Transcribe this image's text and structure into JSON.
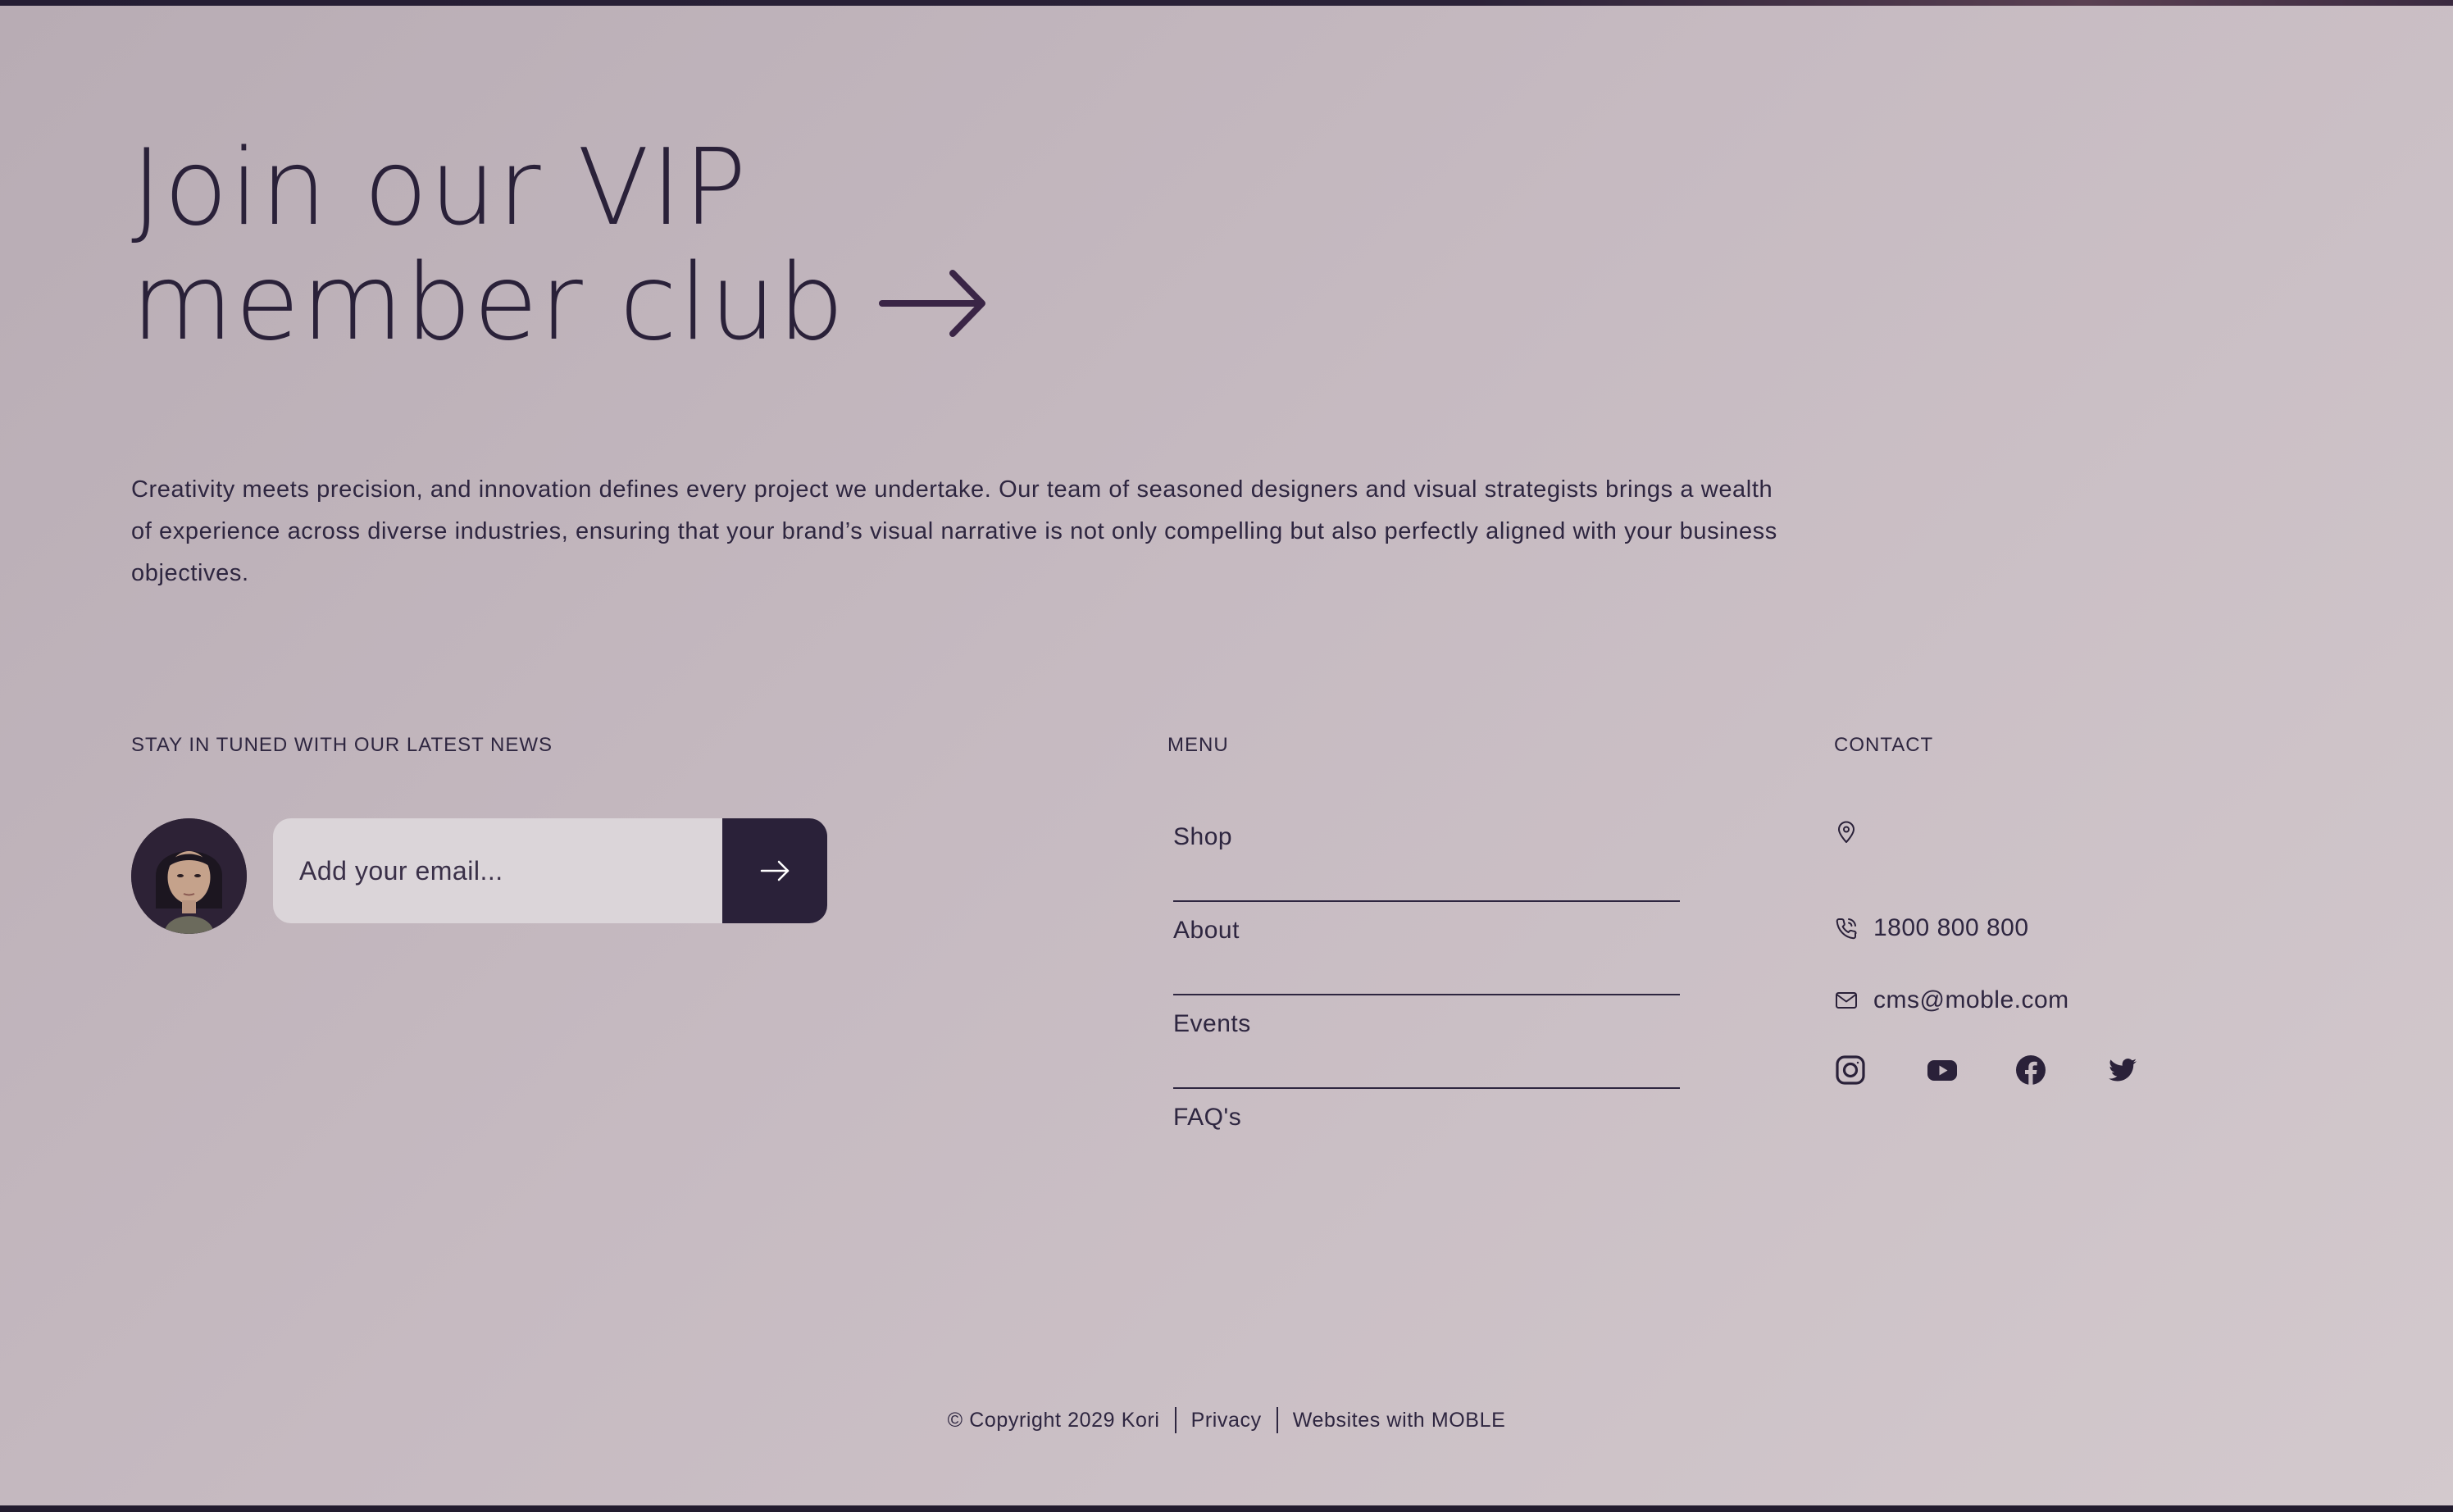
{
  "hero": {
    "title_line1": "Join our VIP",
    "title_line2": "member club"
  },
  "description": "Creativity meets precision, and innovation defines every project we undertake. Our team of seasoned designers and visual strategists brings a wealth of experience across diverse industries, ensuring that your brand’s visual narrative is not only compelling but also perfectly aligned with your business objectives.",
  "newsletter": {
    "label": "STAY IN TUNED WITH OUR LATEST NEWS",
    "email_placeholder": "Add your email...",
    "submit_icon": "arrow-right-icon"
  },
  "menu": {
    "label": "MENU",
    "items": [
      {
        "label": "Shop"
      },
      {
        "label": "About"
      },
      {
        "label": "Events"
      },
      {
        "label": "FAQ's"
      }
    ]
  },
  "contact": {
    "label": "CONTACT",
    "address": "",
    "phone": "1800 800 800",
    "email": "cms@moble.com",
    "socials": [
      "instagram-icon",
      "youtube-icon",
      "facebook-icon",
      "twitter-icon"
    ]
  },
  "footer": {
    "copyright": "© Copyright 2029 Kori",
    "privacy": "Privacy",
    "credit": "Websites with MOBLE"
  },
  "colors": {
    "primary": "#2a2139",
    "input_bg": "#dbd5d9",
    "background": "#c6bac1"
  }
}
